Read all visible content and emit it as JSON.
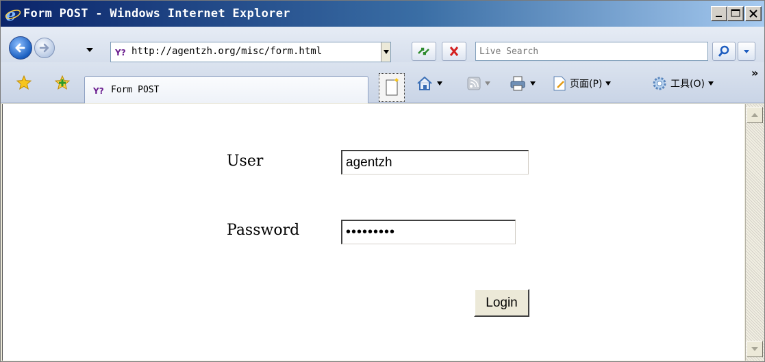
{
  "window": {
    "title": "Form POST - Windows Internet Explorer"
  },
  "toolbar": {
    "address_url": "http://agentzh.org/misc/form.html",
    "search_placeholder": "Live Search"
  },
  "tabs": {
    "active_label": "Form POST"
  },
  "commands": {
    "page_label": "页面(P)",
    "tools_label": "工具(O)",
    "more_label": "»"
  },
  "form": {
    "user_label": "User",
    "user_value": "agentzh",
    "password_label": "Password",
    "password_value": "•••••••••",
    "login_label": "Login"
  },
  "colors": {
    "title_gradient_start": "#0a246a",
    "title_gradient_end": "#a6caf0",
    "window_face": "#ece9d8"
  },
  "icons": [
    "ie-logo-icon",
    "minimize-icon",
    "maximize-icon",
    "close-icon",
    "back-icon",
    "forward-icon",
    "yahoo-favicon-icon",
    "refresh-icon",
    "stop-icon",
    "search-icon",
    "favorites-star-icon",
    "add-favorite-icon",
    "new-tab-icon",
    "home-icon",
    "feeds-icon",
    "print-icon",
    "page-icon",
    "gear-icon",
    "scroll-up-icon",
    "scroll-down-icon"
  ]
}
